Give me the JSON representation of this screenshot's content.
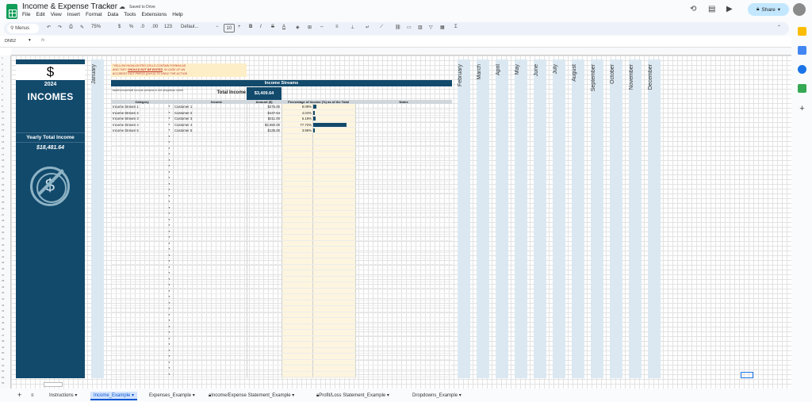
{
  "titlebar": {
    "doc_title": "Income & Expense Tracker",
    "saved_status": "Saved to Drive",
    "share_label": "Share"
  },
  "menu": [
    "File",
    "Edit",
    "View",
    "Insert",
    "Format",
    "Data",
    "Tools",
    "Extensions",
    "Help"
  ],
  "toolbar": {
    "menus_label": "Menus",
    "zoom": "75%",
    "currency": "$",
    "percent": "%",
    "dec_dec": ".0",
    "dec_inc": ".00",
    "num_format": "123",
    "font": "Defaul...",
    "font_size": "10"
  },
  "formula_bar": {
    "cell_ref": "DN52",
    "fx": "fx"
  },
  "left_panel": {
    "dollar": "$",
    "year": "2024",
    "title": "INCOMES",
    "yearly_label": "Yearly Total Income",
    "yearly_value": "$18,481.64"
  },
  "months": [
    "January",
    "February",
    "March",
    "April",
    "May",
    "June",
    "July",
    "August",
    "September",
    "October",
    "November",
    "December"
  ],
  "warning": {
    "line1": "*YELLOW HIGHLIGHTED CELLS CONTAIN FORMULAS",
    "line2a": "AND THEY ",
    "line2b": "SHOULD NOT BE EDITED",
    "line2c": ". IN CASE OF AN",
    "line3": "ACCIDENT EDIT PRESS (Ctrl+Z) TO UNDO THE ACTION"
  },
  "income_streams": {
    "header": "Income Streams",
    "add_note": "*add/remove/edit income streams in the dropdown sheet",
    "total_label": "Total Income",
    "total_value": "$3,409.64",
    "columns": [
      "Category",
      "Income",
      "Amount ($)",
      "Percentage of Income (%) as of the Total",
      "Notes"
    ],
    "rows": [
      {
        "category": "Income Stream 1",
        "income": "Customer 1",
        "amount": "$276.00",
        "pct": "8.09%",
        "pct_value": 8.09
      },
      {
        "category": "Income Stream 2",
        "income": "Customer 2",
        "amount": "$137.64",
        "pct": "4.04%",
        "pct_value": 4.04
      },
      {
        "category": "Income Stream 3",
        "income": "Customer 3",
        "amount": "$211.00",
        "pct": "6.19%",
        "pct_value": 6.19
      },
      {
        "category": "Income Stream 4",
        "income": "Customer 4",
        "amount": "$2,650.00",
        "pct": "77.72%",
        "pct_value": 77.72
      },
      {
        "category": "Income Stream 5",
        "income": "Customer 5",
        "amount": "$135.00",
        "pct": "3.96%",
        "pct_value": 3.96
      }
    ]
  },
  "tabs": [
    {
      "label": "Instructions",
      "locked": false,
      "active": false
    },
    {
      "label": "Income_Example",
      "locked": false,
      "active": true
    },
    {
      "label": "Expenses_Example",
      "locked": false,
      "active": false
    },
    {
      "label": "Income/Expense Statement_Example",
      "locked": true,
      "active": false
    },
    {
      "label": "Profit/Loss Statement_Example",
      "locked": true,
      "active": false
    },
    {
      "label": "Dropdowns_Example",
      "locked": false,
      "active": false
    }
  ],
  "colors": {
    "accent": "#124a6c",
    "yellow": "#fdf5df",
    "month_col": "#dbe8f1"
  }
}
